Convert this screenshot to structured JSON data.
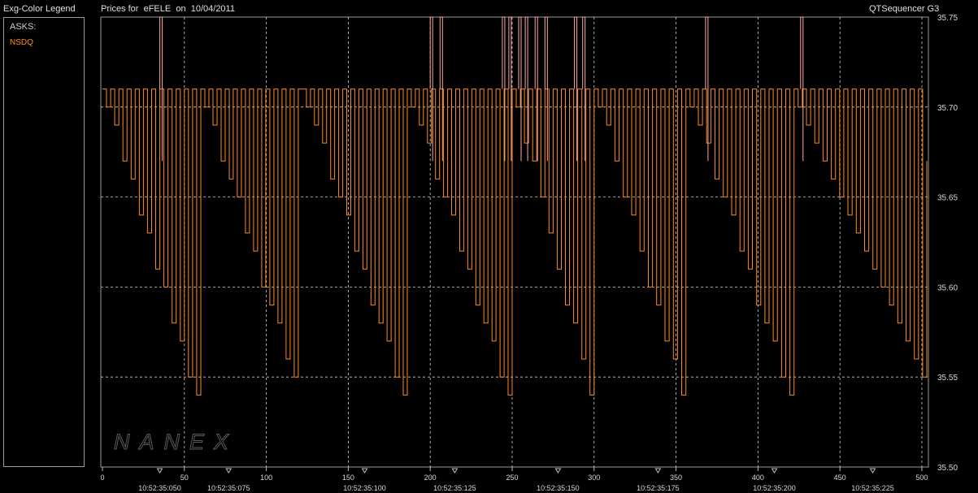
{
  "legend": {
    "panel_title": "Exg-Color Legend",
    "heading": "ASKS:",
    "entries": [
      {
        "label": "NSDQ",
        "color": "#ff8c1a"
      }
    ]
  },
  "header": {
    "title_prefix": "Prices for",
    "symbol": "eFELE",
    "date_prefix": "on",
    "date": "10/04/2011",
    "app_name": "QTSequencer G3"
  },
  "watermark": "NANEX",
  "colors": {
    "ask_line": "#ff8c1a",
    "ask_spike": "#ffa8a0",
    "grid": "#d0d0d0",
    "frame": "#9a9a9a"
  },
  "chart_data": {
    "type": "line",
    "xlim": [
      0,
      503
    ],
    "ylim": [
      35.5,
      35.75
    ],
    "x_ticks": [
      0,
      50,
      100,
      150,
      200,
      250,
      300,
      350,
      400,
      450,
      500
    ],
    "y_ticks": [
      "35.75",
      "35.70",
      "35.65",
      "35.60",
      "35.55",
      "35.50"
    ],
    "time_labels": [
      {
        "label": "10:52:35:050",
        "x": 35
      },
      {
        "label": "10:52:35:075",
        "x": 77
      },
      {
        "label": "10:52:35:100",
        "x": 160
      },
      {
        "label": "10:52:35:125",
        "x": 215
      },
      {
        "label": "10:52:35:150",
        "x": 278
      },
      {
        "label": "10:52:35:175",
        "x": 339
      },
      {
        "label": "10:52:35:200",
        "x": 410
      },
      {
        "label": "10:52:35:225",
        "x": 470
      }
    ],
    "grid": true,
    "series": [
      {
        "name": "NSDQ",
        "cycles": [
          {
            "x0": 0,
            "x1": 60,
            "top": 35.71,
            "bottom": 35.54
          },
          {
            "x0": 60,
            "x1": 122,
            "top": 35.71,
            "bottom": 35.54
          },
          {
            "x0": 122,
            "x1": 186,
            "top": 35.71,
            "bottom": 35.54
          },
          {
            "x0": 186,
            "x1": 250,
            "top": 35.71,
            "bottom": 35.54
          },
          {
            "x0": 250,
            "x1": 300,
            "top": 35.71,
            "bottom": 35.54
          },
          {
            "x0": 300,
            "x1": 356,
            "top": 35.71,
            "bottom": 35.54
          },
          {
            "x0": 356,
            "x1": 422,
            "top": 35.71,
            "bottom": 35.54
          },
          {
            "x0": 422,
            "x1": 503,
            "top": 35.71,
            "bottom": 35.55
          }
        ],
        "spikes": [
          35,
          200,
          206,
          244,
          248,
          254,
          258,
          264,
          270,
          288,
          293,
          368,
          426
        ],
        "spike_high": 35.75,
        "end_value": 35.67
      }
    ]
  }
}
